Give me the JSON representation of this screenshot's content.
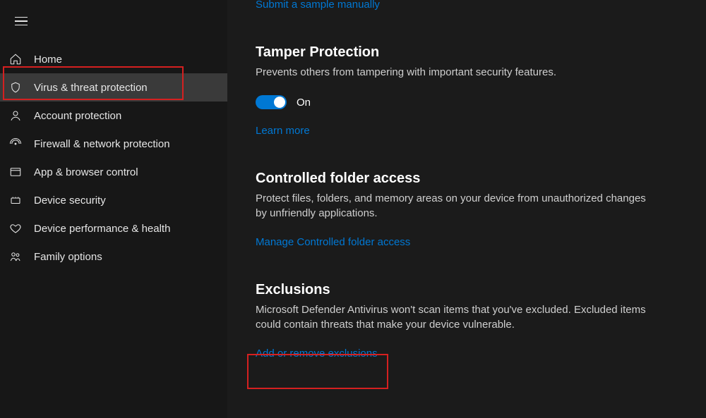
{
  "top_link": "Submit a sample manually",
  "sidebar": {
    "items": [
      {
        "label": "Home"
      },
      {
        "label": "Virus & threat protection"
      },
      {
        "label": "Account protection"
      },
      {
        "label": "Firewall & network protection"
      },
      {
        "label": "App & browser control"
      },
      {
        "label": "Device security"
      },
      {
        "label": "Device performance & health"
      },
      {
        "label": "Family options"
      }
    ]
  },
  "tamper": {
    "title": "Tamper Protection",
    "desc": "Prevents others from tampering with important security features.",
    "toggle_state": "On",
    "learn_more": "Learn more"
  },
  "cfa": {
    "title": "Controlled folder access",
    "desc": "Protect files, folders, and memory areas on your device from unauthorized changes by unfriendly applications.",
    "manage": "Manage Controlled folder access"
  },
  "exclusions": {
    "title": "Exclusions",
    "desc": "Microsoft Defender Antivirus won't scan items that you've excluded. Excluded items could contain threats that make your device vulnerable.",
    "action": "Add or remove exclusions"
  }
}
